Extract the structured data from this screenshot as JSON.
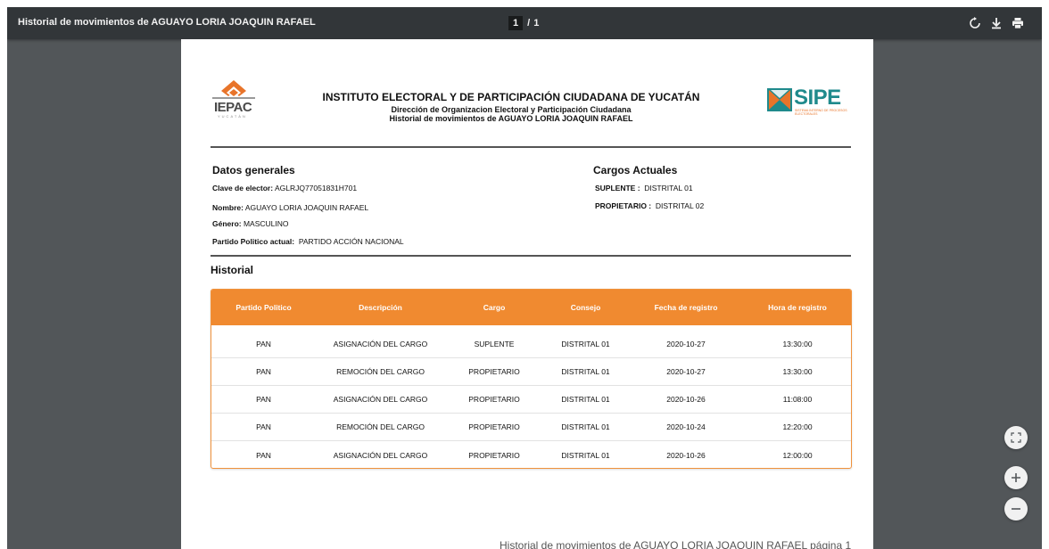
{
  "toolbar": {
    "title": "Historial de movimientos de AGUAYO LORIA JOAQUIN RAFAEL",
    "current_page": "1",
    "page_separator": "/",
    "total_pages": "1",
    "icons": [
      "rotate-icon",
      "download-icon",
      "print-icon"
    ]
  },
  "document": {
    "logo_left_text": "IEPAC",
    "logo_left_sub": "YUCATÁN",
    "logo_right_text": "SIPE",
    "logo_right_sub": "SISTEMA INTERNO DE PROCESOS ELECTORALES",
    "header": {
      "line1": "INSTITUTO ELECTORAL Y DE PARTICIPACIÓN CIUDADANA DE YUCATÁN",
      "line2": "Dirección de Organizacion Electoral y Participación Ciudadana",
      "line3": "Historial de movimientos de AGUAYO LORIA JOAQUIN RAFAEL"
    },
    "general": {
      "title": "Datos generales",
      "clave_label": "Clave de elector:",
      "clave_value": "AGLRJQ77051831H701",
      "nombre_label": "Nombre:",
      "nombre_value": "AGUAYO LORIA JOAQUIN RAFAEL",
      "genero_label": "Género:",
      "genero_value": "MASCULINO",
      "partido_label": "Partido Politico actual:",
      "partido_value": "PARTIDO ACCIÓN NACIONAL"
    },
    "cargos": {
      "title": "Cargos Actuales",
      "items": [
        {
          "label": "SUPLENTE :",
          "value": "DISTRITAL 01"
        },
        {
          "label": "PROPIETARIO :",
          "value": "DISTRITAL 02"
        }
      ]
    },
    "historial": {
      "title": "Historial",
      "columns": [
        "Partido Politico",
        "Descripción",
        "Cargo",
        "Consejo",
        "Fecha de registro",
        "Hora de registro"
      ],
      "rows": [
        [
          "PAN",
          "ASIGNACIÓN DEL CARGO",
          "SUPLENTE",
          "DISTRITAL 01",
          "2020-10-27",
          "13:30:00"
        ],
        [
          "PAN",
          "REMOCIÓN DEL CARGO",
          "PROPIETARIO",
          "DISTRITAL 01",
          "2020-10-27",
          "13:30:00"
        ],
        [
          "PAN",
          "ASIGNACIÓN DEL CARGO",
          "PROPIETARIO",
          "DISTRITAL 01",
          "2020-10-26",
          "11:08:00"
        ],
        [
          "PAN",
          "REMOCIÓN DEL CARGO",
          "PROPIETARIO",
          "DISTRITAL 01",
          "2020-10-24",
          "12:20:00"
        ],
        [
          "PAN",
          "ASIGNACIÓN DEL CARGO",
          "PROPIETARIO",
          "DISTRITAL 01",
          "2020-10-26",
          "12:00:00"
        ]
      ]
    },
    "footer": "Historial de movimientos de AGUAYO LORIA JOAQUIN RAFAEL página 1"
  },
  "controls": {
    "icons": [
      "fit-page-icon",
      "zoom-in-icon",
      "zoom-out-icon"
    ]
  },
  "colors": {
    "toolbar_bg": "#323639",
    "viewer_bg": "#525659",
    "table_header": "#f08a30",
    "iepac_orange": "#e8742a",
    "sipe_teal": "#1f8a8c"
  }
}
